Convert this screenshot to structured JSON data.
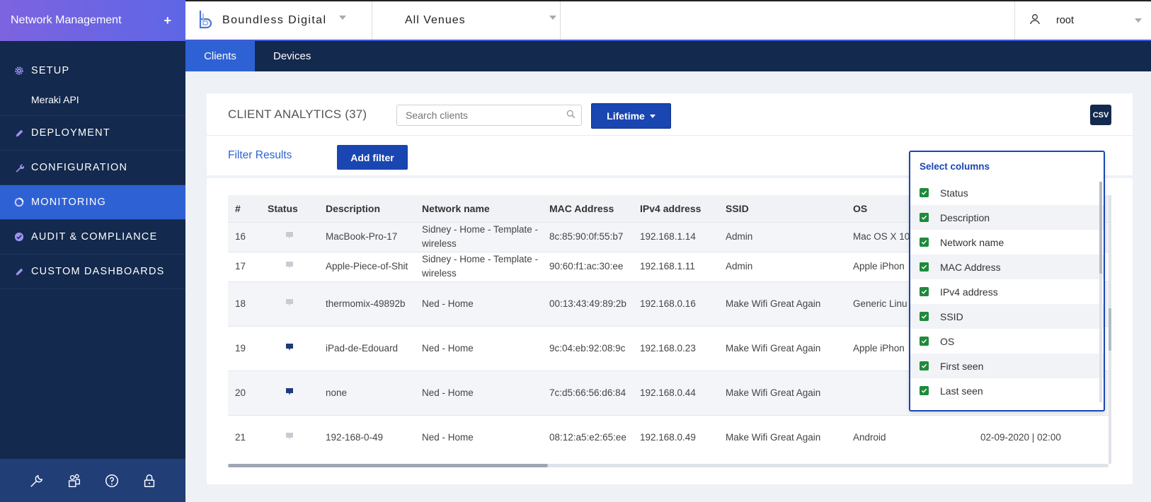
{
  "sidebar": {
    "title": "Network Management",
    "add_symbol": "+",
    "items": [
      {
        "label": "SETUP"
      },
      {
        "label": "Meraki API"
      },
      {
        "label": "DEPLOYMENT"
      },
      {
        "label": "CONFIGURATION"
      },
      {
        "label": "MONITORING"
      },
      {
        "label": "AUDIT & COMPLIANCE"
      },
      {
        "label": "CUSTOM DASHBOARDS"
      }
    ],
    "footer_icons": [
      "wrench-icon",
      "users-icon",
      "help-icon",
      "lock-icon"
    ]
  },
  "header": {
    "org_name": "Boundless Digital",
    "venue": "All Venues",
    "user": "root"
  },
  "tabs": [
    {
      "label": "Clients"
    },
    {
      "label": "Devices"
    }
  ],
  "client_analytics": {
    "title": "CLIENT ANALYTICS (37)",
    "search_placeholder": "Search clients",
    "time_range": "Lifetime",
    "csv_label": "CSV",
    "filter_label": "Filter Results",
    "add_filter_label": "Add filter"
  },
  "table": {
    "columns": [
      "#",
      "Status",
      "Description",
      "Network name",
      "MAC Address",
      "IPv4 address",
      "SSID",
      "OS",
      ""
    ],
    "rows": [
      {
        "num": "16",
        "status": "offline",
        "description": "MacBook-Pro-17",
        "network": "Sidney - Home - Template - wireless",
        "mac": "8c:85:90:0f:55:b7",
        "ipv4": "192.168.1.14",
        "ssid": "Admin",
        "os": "Mac OS X 10.",
        "last": ""
      },
      {
        "num": "17",
        "status": "offline",
        "description": "Apple-Piece-of-Shit",
        "network": "Sidney - Home - Template - wireless",
        "mac": "90:60:f1:ac:30:ee",
        "ipv4": "192.168.1.11",
        "ssid": "Admin",
        "os": "Apple iPhon",
        "last": ""
      },
      {
        "num": "18",
        "status": "offline",
        "description": "thermomix-49892b",
        "network": "Ned - Home",
        "mac": "00:13:43:49:89:2b",
        "ipv4": "192.168.0.16",
        "ssid": "Make Wifi Great Again",
        "os": "Generic Linu",
        "last": ""
      },
      {
        "num": "19",
        "status": "online",
        "description": "iPad-de-Edouard",
        "network": "Ned - Home",
        "mac": "9c:04:eb:92:08:9c",
        "ipv4": "192.168.0.23",
        "ssid": "Make Wifi Great Again",
        "os": "Apple iPhon",
        "last": ""
      },
      {
        "num": "20",
        "status": "online",
        "description": "none",
        "network": "Ned - Home",
        "mac": "7c:d5:66:56:d6:84",
        "ipv4": "192.168.0.44",
        "ssid": "Make Wifi Great Again",
        "os": "",
        "last": ""
      },
      {
        "num": "21",
        "status": "offline",
        "description": "192-168-0-49",
        "network": "Ned - Home",
        "mac": "08:12:a5:e2:65:ee",
        "ipv4": "192.168.0.49",
        "ssid": "Make Wifi Great Again",
        "os": "Android",
        "last": "02-09-2020 | 02:00"
      }
    ]
  },
  "column_picker": {
    "title": "Select columns",
    "options": [
      {
        "label": "Status",
        "checked": true
      },
      {
        "label": "Description",
        "checked": true
      },
      {
        "label": "Network name",
        "checked": true
      },
      {
        "label": "MAC Address",
        "checked": true
      },
      {
        "label": "IPv4 address",
        "checked": true
      },
      {
        "label": "SSID",
        "checked": true
      },
      {
        "label": "OS",
        "checked": true
      },
      {
        "label": "First seen",
        "checked": true
      },
      {
        "label": "Last seen",
        "checked": true
      }
    ]
  },
  "colors": {
    "sidebar_bg": "#13294d",
    "accent": "#2e62d4",
    "button": "#1a46b2",
    "checkbox": "#1f8a3b",
    "online_status": "#1f3a7a",
    "offline_status": "#c8ccd2"
  }
}
